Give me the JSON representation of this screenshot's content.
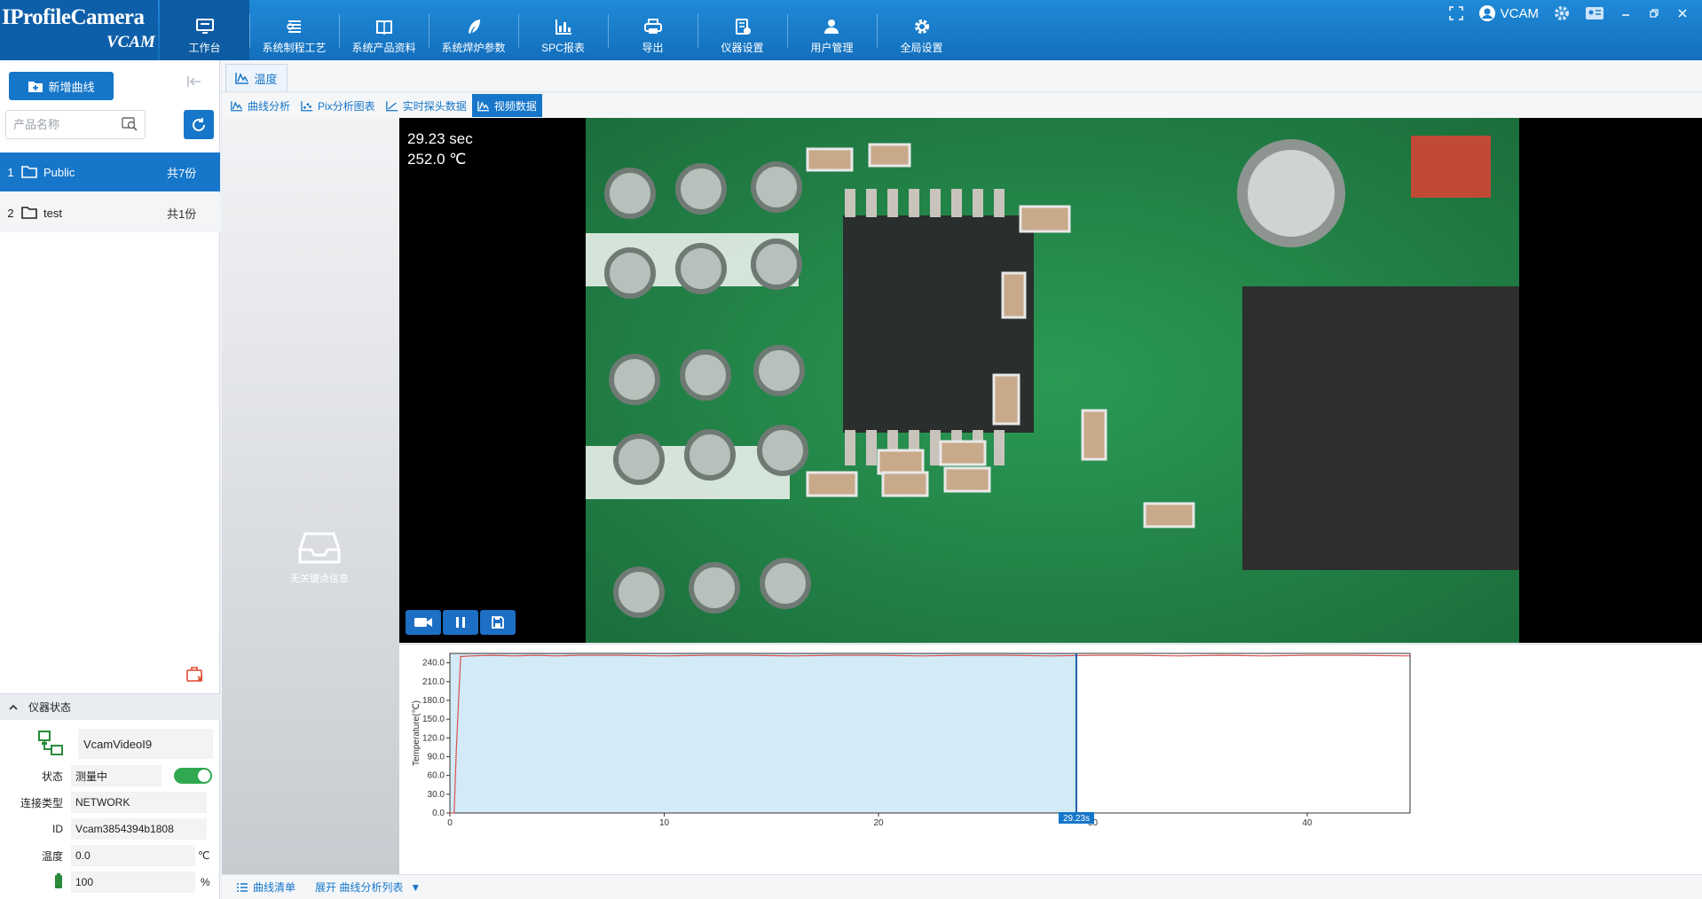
{
  "app": {
    "logo_main": "IProfileCamera",
    "logo_sub": "VCAM"
  },
  "nav": [
    {
      "label": "工作台",
      "icon": "monitor-icon"
    },
    {
      "label": "系统制程工艺",
      "icon": "layers-icon"
    },
    {
      "label": "系统产品资料",
      "icon": "book-icon"
    },
    {
      "label": "系统焊炉参数",
      "icon": "feather-icon"
    },
    {
      "label": "SPC报表",
      "icon": "bar-chart-icon"
    },
    {
      "label": "导出",
      "icon": "printer-icon"
    },
    {
      "label": "仪器设置",
      "icon": "device-settings-icon"
    },
    {
      "label": "用户管理",
      "icon": "users-icon"
    },
    {
      "label": "全局设置",
      "icon": "gear-icon"
    }
  ],
  "topright": {
    "user": "VCAM"
  },
  "left": {
    "new_curve_label": "新增曲线",
    "search_placeholder": "产品名称",
    "folders": [
      {
        "index": "1",
        "name": "Public",
        "count": "共7份"
      },
      {
        "index": "2",
        "name": "test",
        "count": "共1份"
      }
    ],
    "status_header": "仪器状态",
    "device_name": "VcamVideoI9",
    "rows": {
      "status_label": "状态",
      "status_value": "测量中",
      "conn_label": "连接类型",
      "conn_value": "NETWORK",
      "id_label": "ID",
      "id_value": "Vcam3854394b1808",
      "temp_label": "温度",
      "temp_value": "0.0",
      "temp_unit": "℃",
      "battery_value": "100",
      "battery_unit": "%"
    }
  },
  "main": {
    "top_tab": "温度",
    "sub_tabs": [
      "曲线分析",
      "Pix分析图表",
      "实时探头数据",
      "视频数据"
    ],
    "active_sub_tab": 3,
    "no_key_info": "无关键点信息",
    "video_time": "29.23 sec",
    "video_temp": "252.0 ℃",
    "bottom_list": "曲线清单",
    "bottom_expand": "展开 曲线分析列表",
    "bottom_expand_arrow": "▼"
  },
  "chart_data": {
    "type": "line",
    "ylabel": "Temperature(℃)",
    "yticks": [
      "0.0",
      "30.0",
      "60.0",
      "90.0",
      "120.0",
      "150.0",
      "180.0",
      "210.0",
      "240.0"
    ],
    "xticks": [
      "0",
      "10",
      "20",
      "30",
      "40"
    ],
    "xlim": [
      0,
      44.8
    ],
    "ylim": [
      0,
      255
    ],
    "cursor_x": 29.23,
    "cursor_label": "29.23s",
    "series": [
      {
        "color": "#d9534f",
        "x": [
          0,
          0.2,
          0.3,
          0.5,
          1,
          2,
          3,
          4,
          5,
          6,
          8,
          10,
          12,
          14,
          16,
          18,
          20,
          22,
          24,
          26,
          28,
          30,
          32,
          34,
          36,
          38,
          40,
          42,
          44.8
        ],
        "values": [
          0,
          0,
          100,
          250,
          251,
          252,
          251,
          252,
          251,
          252,
          252,
          251,
          252,
          252,
          251,
          252,
          252,
          251,
          252,
          252,
          251,
          252,
          252,
          251,
          252,
          251,
          252,
          252,
          251
        ]
      }
    ]
  },
  "colors": {
    "primary": "#1676c9",
    "topbar": "#1a7fd1",
    "curve": "#d9534f",
    "fill": "#d3eaf7",
    "toggle_on": "#2fa84f",
    "delete": "#e0492f"
  }
}
